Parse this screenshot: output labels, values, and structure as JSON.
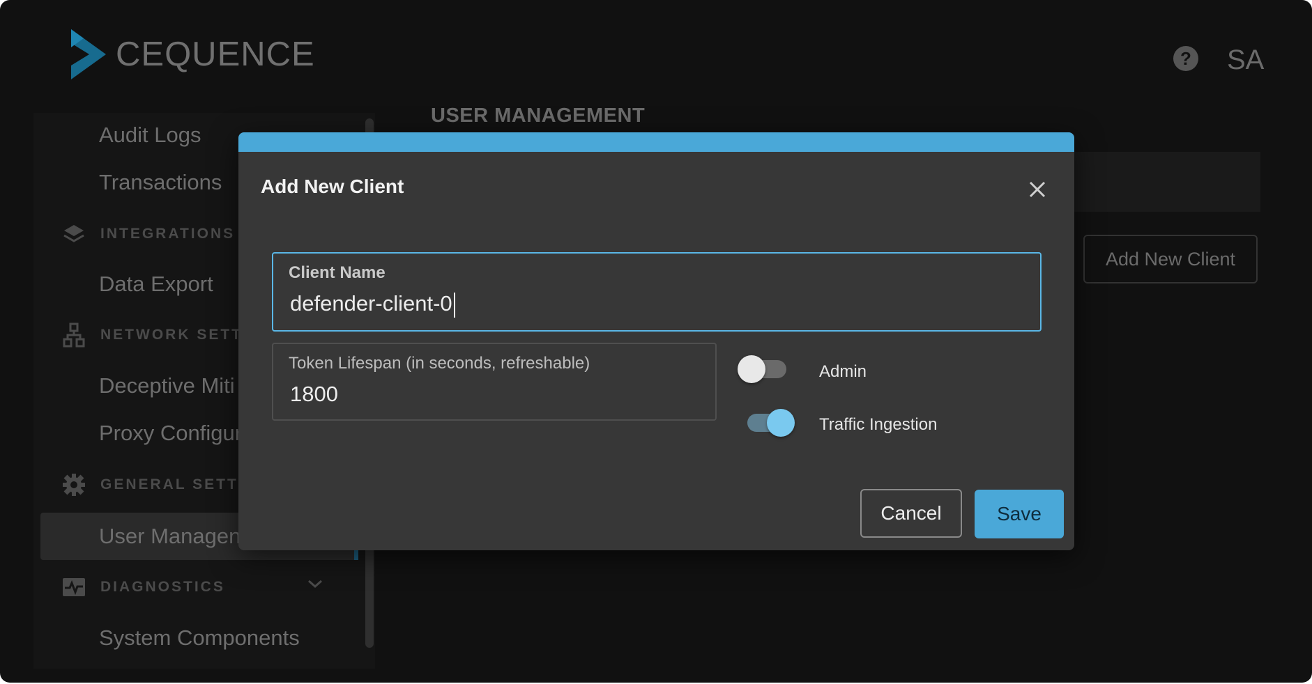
{
  "brand": {
    "logo_text": "CEQUENCE"
  },
  "header": {
    "help_icon": "?",
    "avatar_initials": "SA"
  },
  "sidebar": {
    "items": {
      "audit_logs": "Audit Logs",
      "transactions": "Transactions",
      "integrations": "INTEGRATIONS",
      "data_export": "Data Export",
      "network_settings": "NETWORK SETTIN",
      "deceptive": "Deceptive Miti",
      "proxy": "Proxy Configur",
      "general_settings": "GENERAL SETTIN",
      "user_management": "User Managen",
      "diagnostics": "DIAGNOSTICS",
      "system_components": "System Components"
    }
  },
  "main": {
    "page_title": "USER MANAGEMENT",
    "add_new_client_button": "Add New Client"
  },
  "modal": {
    "title": "Add New Client",
    "client_name": {
      "label": "Client Name",
      "value": "defender-client-0"
    },
    "token_lifespan": {
      "label": "Token Lifespan (in seconds, refreshable)",
      "value": "1800"
    },
    "admin": {
      "label": "Admin",
      "checked": false
    },
    "traffic_ingestion": {
      "label": "Traffic Ingestion",
      "checked": true
    },
    "cancel_label": "Cancel",
    "save_label": "Save"
  },
  "colors": {
    "accent": "#4aa8d8",
    "modal_bg": "#373737",
    "app_bg": "#111111"
  }
}
